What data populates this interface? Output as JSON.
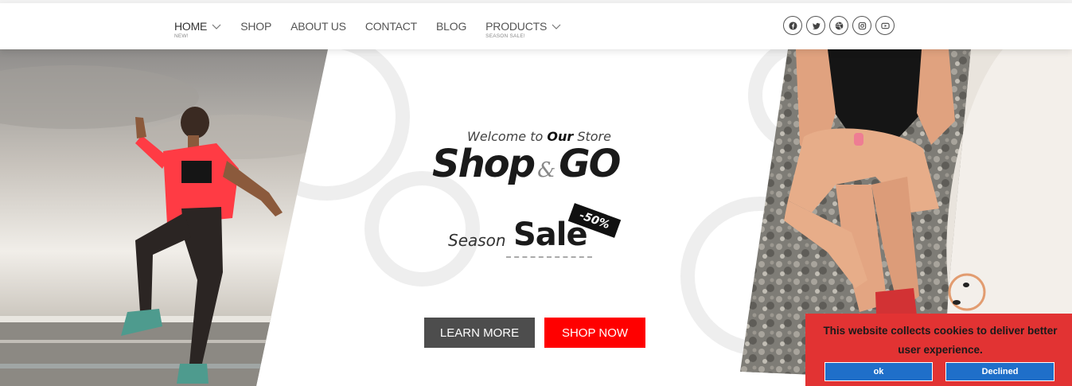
{
  "nav": {
    "items": [
      {
        "label": "HOME",
        "sub": "NEW!",
        "dropdown": true,
        "active": true
      },
      {
        "label": "SHOP",
        "sub": "",
        "dropdown": false
      },
      {
        "label": "ABOUT US",
        "sub": "",
        "dropdown": false
      },
      {
        "label": "CONTACT",
        "sub": "",
        "dropdown": false
      },
      {
        "label": "BLOG",
        "sub": "",
        "dropdown": false
      },
      {
        "label": "PRODUCTS",
        "sub": "SEASON SALE!",
        "dropdown": true
      }
    ]
  },
  "social": [
    "facebook-icon",
    "twitter-icon",
    "dribbble-icon",
    "instagram-icon",
    "youtube-icon"
  ],
  "hero": {
    "welcome_pre": "Welcome to ",
    "welcome_bold": "Our",
    "welcome_post": " Store",
    "title_left": "Shop",
    "title_amp": "&",
    "title_right": "GO",
    "season": "Season",
    "sale": "Sale",
    "badge": "-50%",
    "learn_more": "LEARN MORE",
    "shop_now": "SHOP NOW"
  },
  "cookie": {
    "message": "This website collects cookies to deliver better user experience.",
    "ok_label": "ok",
    "decline_label": "Declined"
  },
  "colors": {
    "accent": "#ff0000",
    "dark_button": "#4d4d4d",
    "cookie_bg": "#e23333",
    "cookie_button": "#1f6fc9"
  }
}
